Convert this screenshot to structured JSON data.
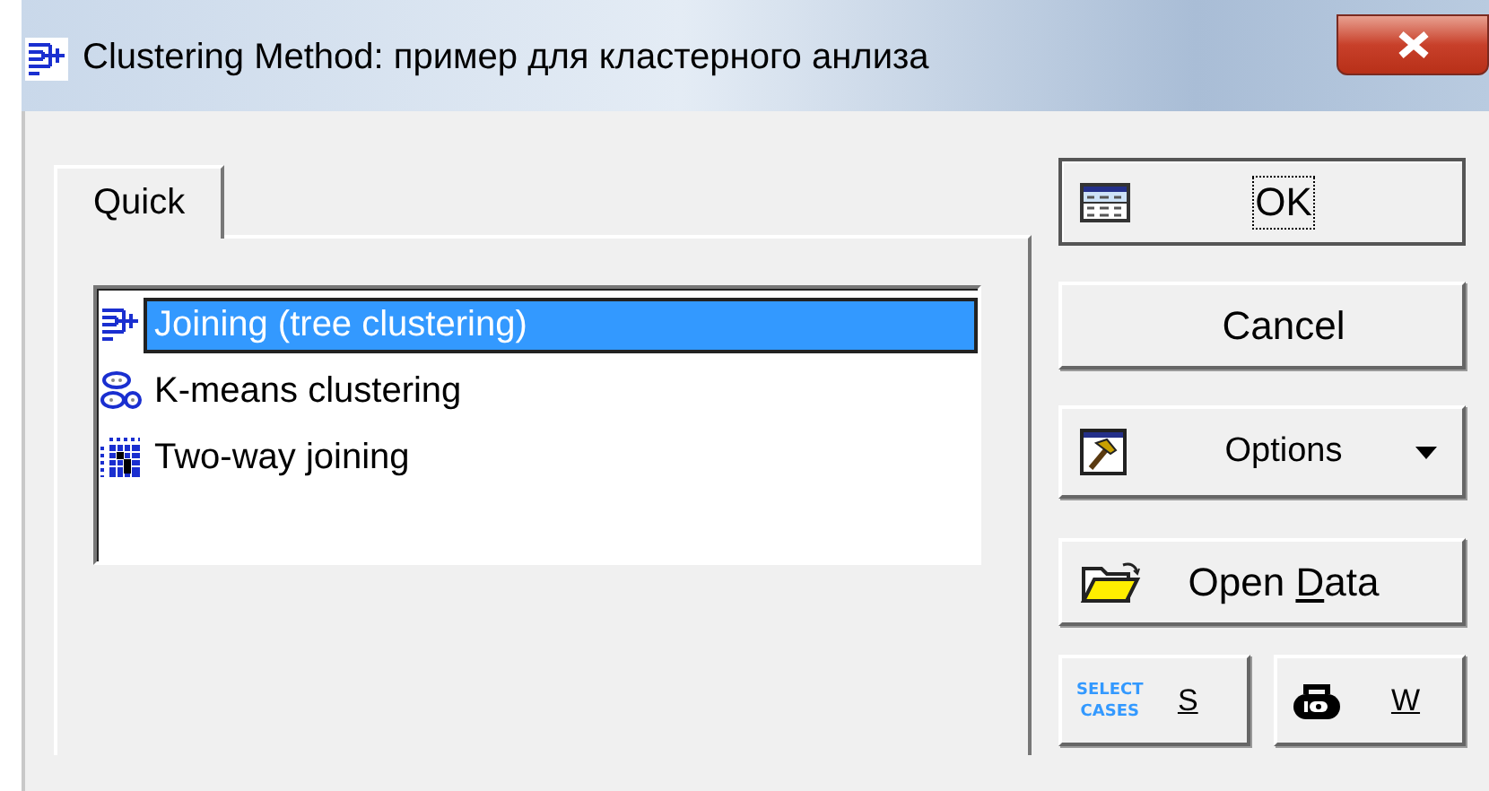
{
  "window": {
    "title": "Clustering Method: пример для кластерного анлиза"
  },
  "tabs": [
    {
      "label": "Quick",
      "selected": true
    }
  ],
  "methods": [
    {
      "label": "Joining (tree clustering)",
      "selected": true,
      "kind": "tree"
    },
    {
      "label": "K-means clustering",
      "selected": false,
      "kind": "kmeans"
    },
    {
      "label": "Two-way joining",
      "selected": false,
      "kind": "twoway"
    }
  ],
  "buttons": [
    {
      "kind": "ok",
      "label_parts": [
        {
          "text": "OK",
          "underline": false
        }
      ],
      "focused": true
    },
    {
      "kind": "cancel",
      "label_parts": [
        {
          "text": "Cancel",
          "underline": false
        }
      ],
      "focused": false
    },
    {
      "kind": "options",
      "label_parts": [
        {
          "text": "Options",
          "underline": false
        }
      ],
      "focused": false
    },
    {
      "kind": "open",
      "label_parts": [
        {
          "text": "Open ",
          "underline": false
        },
        {
          "text": "D",
          "underline": true
        },
        {
          "text": "ata",
          "underline": false
        }
      ],
      "focused": false
    }
  ],
  "small_buttons": [
    {
      "kind": "select",
      "icon_text": [
        "SELECT",
        "CASES"
      ],
      "label": "S",
      "underline": true
    },
    {
      "kind": "weight",
      "label": "W",
      "underline": true
    }
  ]
}
